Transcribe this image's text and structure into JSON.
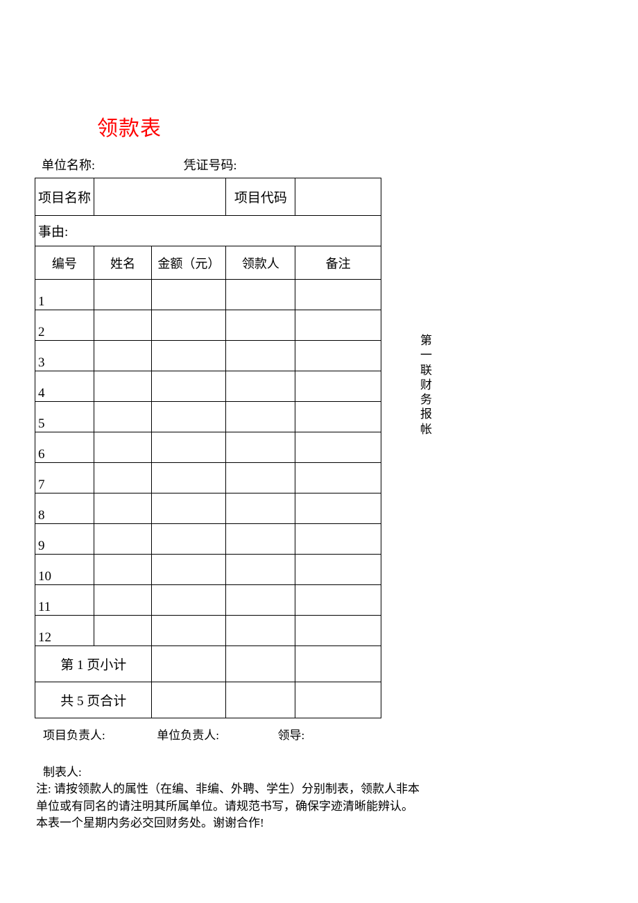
{
  "title": "领款表",
  "header": {
    "unit_label": "单位名称:",
    "voucher_label": "凭证号码:"
  },
  "project": {
    "name_label": "项目名称",
    "name_value": "",
    "code_label": "项目代码",
    "code_value": ""
  },
  "reason_label": "事由:",
  "columns": {
    "index": "编号",
    "name": "姓名",
    "amount": "金额（元）",
    "recipient": "领款人",
    "note": "备注"
  },
  "rows": [
    {
      "idx": "1",
      "name": "",
      "amount": "",
      "recipient": "",
      "note": ""
    },
    {
      "idx": "2",
      "name": "",
      "amount": "",
      "recipient": "",
      "note": ""
    },
    {
      "idx": "3",
      "name": "",
      "amount": "",
      "recipient": "",
      "note": ""
    },
    {
      "idx": "4",
      "name": "",
      "amount": "",
      "recipient": "",
      "note": ""
    },
    {
      "idx": "5",
      "name": "",
      "amount": "",
      "recipient": "",
      "note": ""
    },
    {
      "idx": "6",
      "name": "",
      "amount": "",
      "recipient": "",
      "note": ""
    },
    {
      "idx": "7",
      "name": "",
      "amount": "",
      "recipient": "",
      "note": ""
    },
    {
      "idx": "8",
      "name": "",
      "amount": "",
      "recipient": "",
      "note": ""
    },
    {
      "idx": "9",
      "name": "",
      "amount": "",
      "recipient": "",
      "note": ""
    },
    {
      "idx": "10",
      "name": "",
      "amount": "",
      "recipient": "",
      "note": ""
    },
    {
      "idx": "11",
      "name": "",
      "amount": "",
      "recipient": "",
      "note": ""
    },
    {
      "idx": "12",
      "name": "",
      "amount": "",
      "recipient": "",
      "note": ""
    }
  ],
  "subtotal_label": "第 1 页小计",
  "grandtotal_label": "共 5 页合计",
  "side_label": "第一联财务报帐",
  "footer": {
    "proj_leader": "项目负责人:",
    "unit_leader": "单位负责人:",
    "leader": "领导:",
    "maker": "制表人:",
    "note": "注: 请按领款人的属性（在编、非编、外聘、学生）分别制表，领款人非本单位或有同名的请注明其所属单位。请规范书写，确保字迹清晰能辨认。本表一个星期内务必交回财务处。谢谢合作!"
  }
}
